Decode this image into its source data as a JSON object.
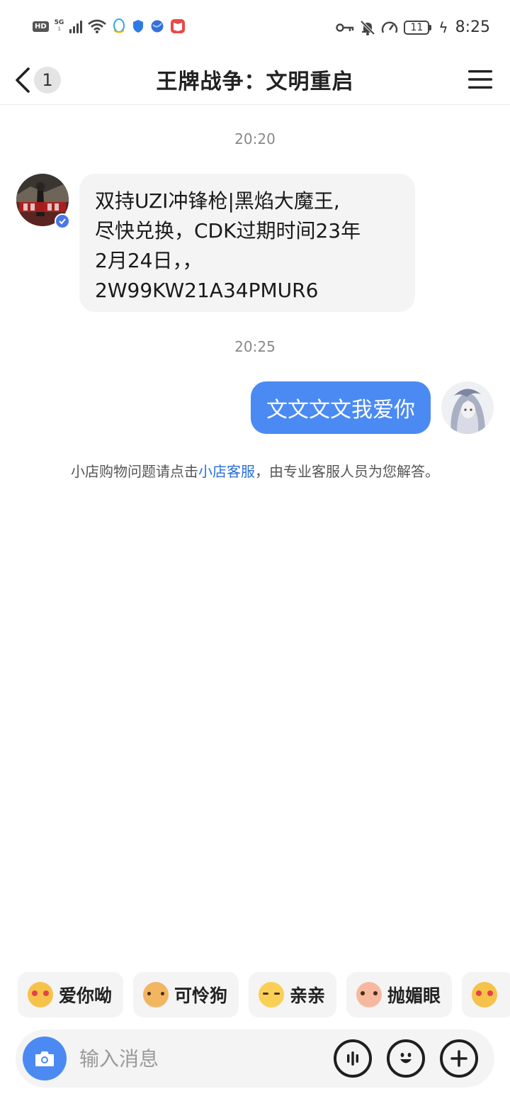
{
  "status_bar": {
    "left_badge": "HD",
    "network_type": "5G",
    "network_sub": "1",
    "battery_level": "11",
    "time": "8:25",
    "left_icons": [
      "hd-icon",
      "signal-icon",
      "wifi-icon",
      "qq-icon",
      "shield-icon",
      "browser-icon",
      "reader-icon"
    ],
    "right_icons": [
      "key-icon",
      "mute-bell-icon",
      "speedometer-icon",
      "battery-icon",
      "charging-icon"
    ]
  },
  "header": {
    "unread_count": "1",
    "title": "王牌战争：文明重启"
  },
  "chat": {
    "messages": [
      {
        "timestamp": "20:20",
        "direction": "incoming",
        "lines": [
          "双持UZI冲锋枪|黑焰大魔王,",
          "尽快兑换，CDK过期时间23年",
          "2月24日，，",
          "2W99KW21A34PMUR6"
        ]
      },
      {
        "timestamp": "20:25",
        "direction": "outgoing",
        "text": "文文文文我爱你"
      }
    ],
    "notice": {
      "before": "小店购物问题请点击",
      "link": "小店客服",
      "after": "，由专业客服人员为您解答。"
    }
  },
  "quick_replies": [
    {
      "label": "爱你呦",
      "icon": "heart-eyes-emoji-icon"
    },
    {
      "label": "可怜狗",
      "icon": "puppy-emoji-icon"
    },
    {
      "label": "亲亲",
      "icon": "kiss-emoji-icon"
    },
    {
      "label": "抛媚眼",
      "icon": "wink-emoji-icon"
    },
    {
      "label": "",
      "icon": "party-emoji-icon"
    }
  ],
  "composer": {
    "placeholder": "输入消息",
    "buttons": [
      "camera-icon",
      "voice-icon",
      "emoji-icon",
      "plus-icon"
    ]
  },
  "colors": {
    "accent_blue": "#4b8af3",
    "bubble_gray": "#f4f4f4",
    "link_blue": "#2a6fd6",
    "verified_blue": "#4a76e8"
  }
}
